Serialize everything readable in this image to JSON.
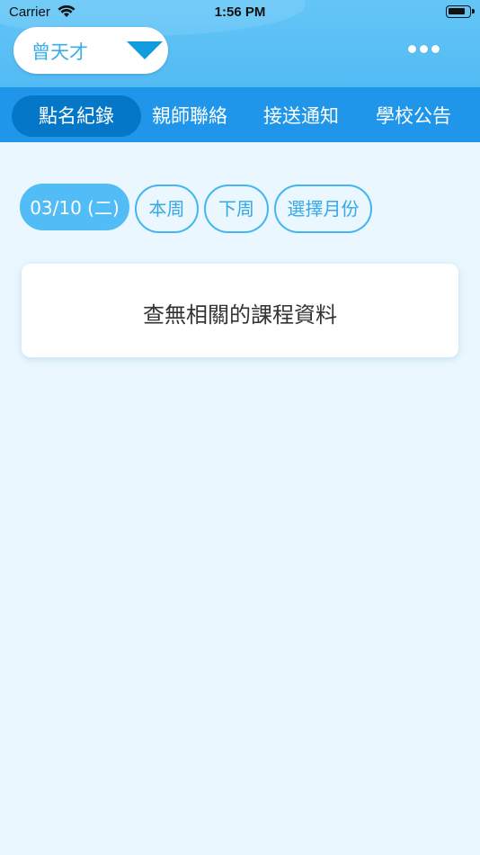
{
  "status_bar": {
    "carrier": "Carrier",
    "time": "1:56 PM"
  },
  "header": {
    "student_name": "曾天才"
  },
  "tabs": [
    {
      "label": "點名紀錄",
      "active": true
    },
    {
      "label": "親師聯絡",
      "active": false
    },
    {
      "label": "接送通知",
      "active": false
    },
    {
      "label": "學校公告",
      "active": false
    }
  ],
  "date_filters": [
    {
      "label": "03/10 (二)",
      "active": true
    },
    {
      "label": "本周",
      "active": false
    },
    {
      "label": "下周",
      "active": false
    },
    {
      "label": "選擇月份",
      "active": false
    }
  ],
  "empty_message": "查無相關的課程資料",
  "colors": {
    "header": "#52baf3",
    "tabbar": "#1f96ea",
    "active_tab": "#0577c8",
    "background": "#eaf7ff",
    "accent": "#42b5f0"
  }
}
